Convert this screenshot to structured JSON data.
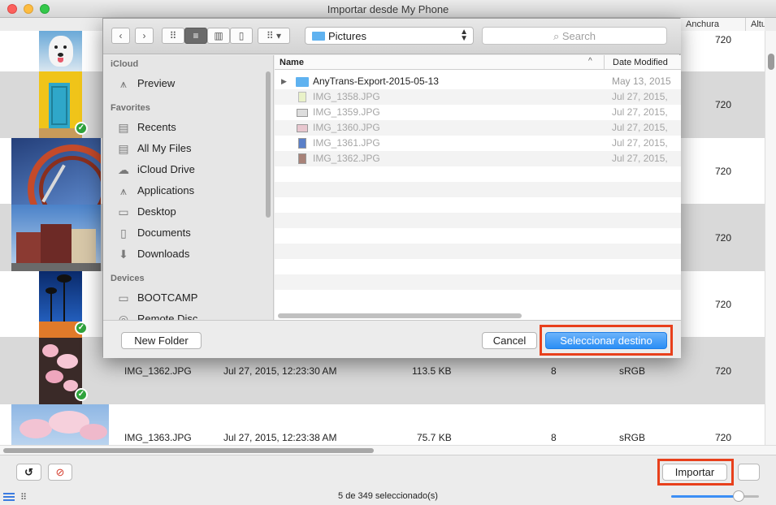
{
  "window": {
    "title": "Importar desde My Phone"
  },
  "table": {
    "columns": {
      "width": "Anchura",
      "height_partial": "Altu"
    },
    "rows": [
      {
        "name": "",
        "date": "",
        "size": "",
        "depth": "",
        "profile": "",
        "width": "720",
        "checked": false
      },
      {
        "name": "",
        "date": "",
        "size": "",
        "depth": "",
        "profile": "",
        "width": "720",
        "checked": true
      },
      {
        "name": "",
        "date": "",
        "size": "",
        "depth": "",
        "profile": "",
        "width": "720",
        "checked": false
      },
      {
        "name": "",
        "date": "",
        "size": "",
        "depth": "",
        "profile": "",
        "width": "720",
        "checked": false
      },
      {
        "name": "",
        "date": "",
        "size": "",
        "depth": "",
        "profile": "",
        "width": "720",
        "checked": true
      },
      {
        "name": "IMG_1362.JPG",
        "date": "Jul 27, 2015, 12:23:30 AM",
        "size": "113.5 KB",
        "depth": "8",
        "profile": "sRGB",
        "width": "720",
        "checked": true
      },
      {
        "name": "IMG_1363.JPG",
        "date": "Jul 27, 2015, 12:23:38 AM",
        "size": "75.7 KB",
        "depth": "8",
        "profile": "sRGB",
        "width": "720",
        "checked": false
      }
    ]
  },
  "dialog": {
    "location": "Pictures",
    "search_placeholder": "Search",
    "sidebar": {
      "icloud_header": "iCloud",
      "icloud_items": [
        "Preview"
      ],
      "favorites_header": "Favorites",
      "favorites_items": [
        "Recents",
        "All My Files",
        "iCloud Drive",
        "Applications",
        "Desktop",
        "Documents",
        "Downloads"
      ],
      "devices_header": "Devices",
      "devices_items": [
        "BOOTCAMP",
        "Remote Disc"
      ]
    },
    "files": {
      "col_name": "Name",
      "col_date": "Date Modified",
      "items": [
        {
          "name": "AnyTrans-Export-2015-05-13",
          "date": "May 13, 2015",
          "kind": "folder"
        },
        {
          "name": "IMG_1358.JPG",
          "date": "Jul 27, 2015,",
          "kind": "image"
        },
        {
          "name": "IMG_1359.JPG",
          "date": "Jul 27, 2015,",
          "kind": "image"
        },
        {
          "name": "IMG_1360.JPG",
          "date": "Jul 27, 2015,",
          "kind": "image"
        },
        {
          "name": "IMG_1361.JPG",
          "date": "Jul 27, 2015,",
          "kind": "image"
        },
        {
          "name": "IMG_1362.JPG",
          "date": "Jul 27, 2015,",
          "kind": "image"
        }
      ]
    },
    "new_folder_label": "New Folder",
    "cancel_label": "Cancel",
    "select_label": "Seleccionar destino"
  },
  "bottom": {
    "import_label": "Importar",
    "status": "5 de 349 seleccionado(s)",
    "zoom_level": 0.77
  },
  "colors": {
    "accent": "#2a8ef5",
    "highlight": "#e8401c",
    "check": "#2fa33c"
  }
}
